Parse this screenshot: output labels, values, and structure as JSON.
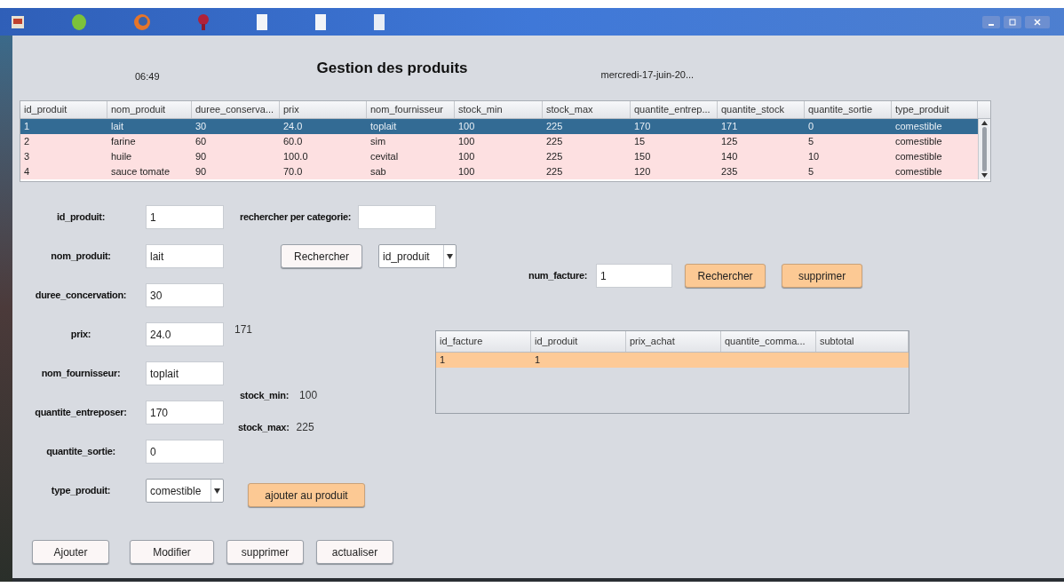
{
  "header": {
    "time": "06:49",
    "title": "Gestion des produits",
    "date": "mercredi-17-juin-20..."
  },
  "products_table": {
    "columns": [
      "id_produit",
      "nom_produit",
      "duree_conserva...",
      "prix",
      "nom_fournisseur",
      "stock_min",
      "stock_max",
      "quantite_entrep...",
      "quantite_stock",
      "quantite_sortie",
      "type_produit"
    ],
    "rows": [
      {
        "cells": [
          "1",
          "lait",
          "30",
          "24.0",
          "toplait",
          "100",
          "225",
          "170",
          "171",
          "0",
          "comestible"
        ],
        "selected": true
      },
      {
        "cells": [
          "2",
          "farine",
          "60",
          "60.0",
          "sim",
          "100",
          "225",
          "15",
          "125",
          "5",
          "comestible"
        ],
        "selected": false
      },
      {
        "cells": [
          "3",
          "huile",
          "90",
          "100.0",
          "cevital",
          "100",
          "225",
          "150",
          "140",
          "10",
          "comestible"
        ],
        "selected": false
      },
      {
        "cells": [
          "4",
          "sauce tomate",
          "90",
          "70.0",
          "sab",
          "100",
          "225",
          "120",
          "235",
          "5",
          "comestible"
        ],
        "selected": false
      }
    ]
  },
  "form": {
    "fields": [
      {
        "label": "id_produit:",
        "value": "1",
        "kind": "text"
      },
      {
        "label": "nom_produit:",
        "value": "lait",
        "kind": "text"
      },
      {
        "label": "duree_concervation:",
        "value": "30",
        "kind": "text"
      },
      {
        "label": "prix:",
        "value": "24.0",
        "kind": "text"
      },
      {
        "label": "nom_fournisseur:",
        "value": "toplait",
        "kind": "text"
      },
      {
        "label": "quantite_entreposer:",
        "value": "170",
        "kind": "text"
      },
      {
        "label": "quantite_sortie:",
        "value": "0",
        "kind": "text"
      },
      {
        "label": "type_produit:",
        "value": "comestible",
        "kind": "select"
      }
    ]
  },
  "search": {
    "label": "rechercher per categorie:",
    "button": "Rechercher",
    "sort_by": "id_produit"
  },
  "stock_info": {
    "quantite_stock": "171",
    "stock_min_label": "stock_min:",
    "stock_min": "100",
    "stock_max_label": "stock_max:",
    "stock_max": "225"
  },
  "add_to_product_button": "ajouter au produit",
  "invoice": {
    "label": "num_facture:",
    "value": "1",
    "buttons": [
      "Rechercher",
      "supprimer"
    ],
    "table": {
      "columns": [
        "id_facture",
        "id_produit",
        "prix_achat",
        "quantite_comma...",
        "subtotal"
      ],
      "rows": [
        {
          "cells": [
            "1",
            "1"
          ],
          "selected": true
        }
      ]
    }
  },
  "actions": [
    "Ajouter",
    "Modifier",
    "supprimer",
    "actualiser"
  ]
}
